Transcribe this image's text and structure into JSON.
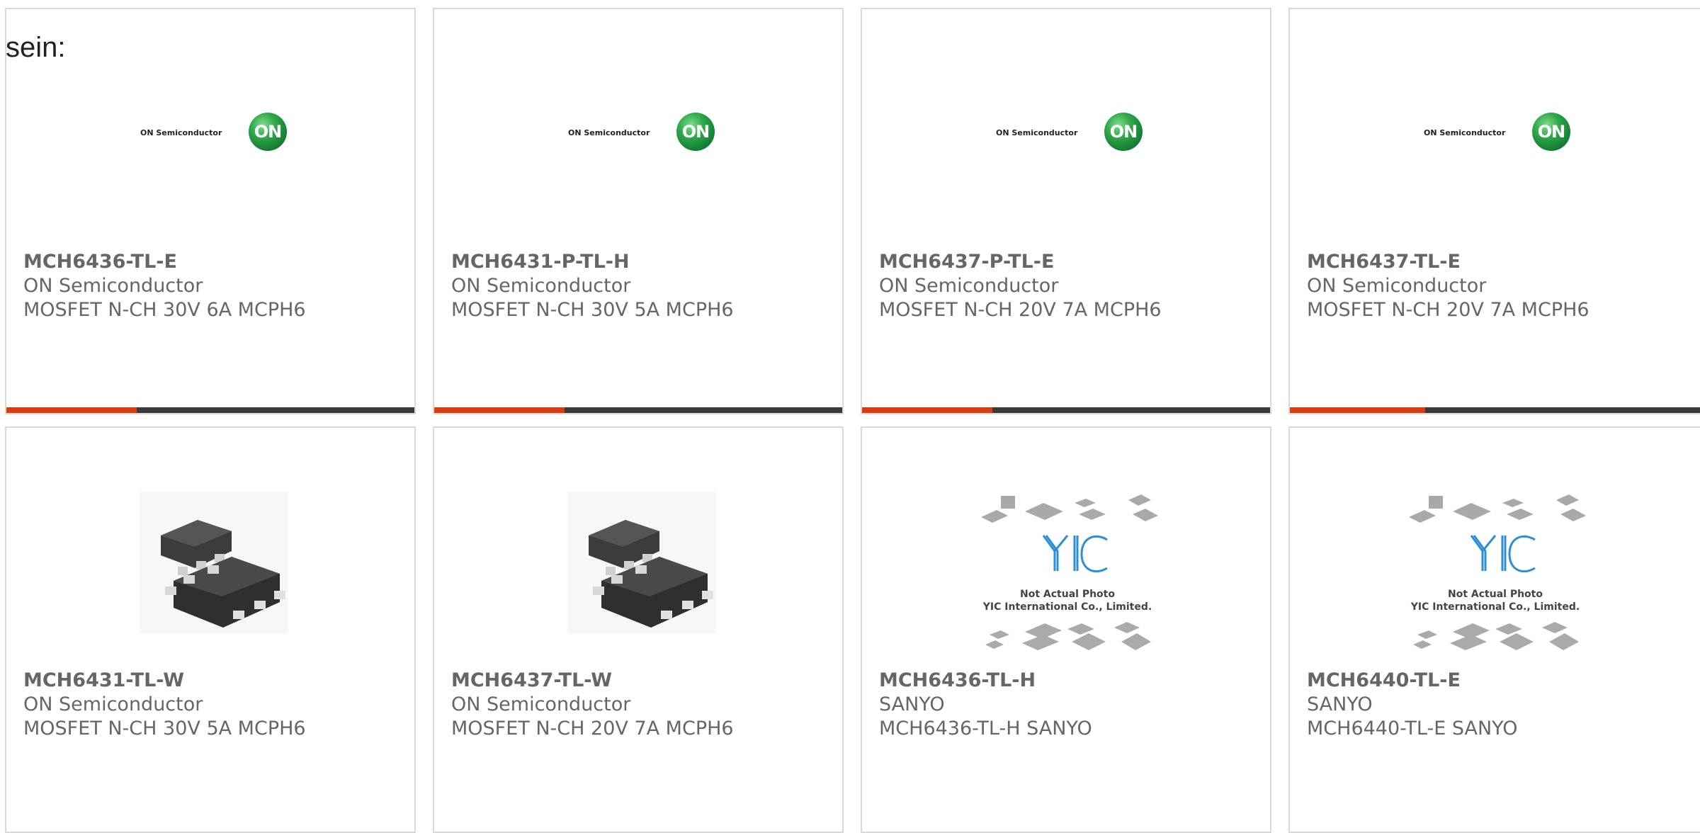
{
  "intro_text": "sein:",
  "logos": {
    "on_semiconductor_text": "ON Semiconductor",
    "on_ball_text": "ON",
    "yic_mark": "YIC",
    "yic_line1": "Not Actual Photo",
    "yic_line2": "YIC International Co., Limited."
  },
  "colors": {
    "progress_fill": "#e0380f",
    "progress_track": "#3a3a3a",
    "on_logo_green": "#2fa84a"
  },
  "products": [
    {
      "part": "MCH6436-TL-E",
      "maker": "ON Semiconductor",
      "desc": "MOSFET N-CH 30V 6A MCPH6",
      "image": "on-semiconductor-logo",
      "progress": 0.32
    },
    {
      "part": "MCH6431-P-TL-H",
      "maker": "ON Semiconductor",
      "desc": "MOSFET N-CH 30V 5A MCPH6",
      "image": "on-semiconductor-logo",
      "progress": 0.32
    },
    {
      "part": "MCH6437-P-TL-E",
      "maker": "ON Semiconductor",
      "desc": "MOSFET N-CH 20V 7A MCPH6",
      "image": "on-semiconductor-logo",
      "progress": 0.32
    },
    {
      "part": "MCH6437-TL-E",
      "maker": "ON Semiconductor",
      "desc": "MOSFET N-CH 20V 7A MCPH6",
      "image": "on-semiconductor-logo",
      "progress": 0.32
    },
    {
      "part": "MCH6431-TL-W",
      "maker": "ON Semiconductor",
      "desc": "MOSFET N-CH 30V 5A MCPH6",
      "image": "mcph6-chip-photo"
    },
    {
      "part": "MCH6437-TL-W",
      "maker": "ON Semiconductor",
      "desc": "MOSFET N-CH 20V 7A MCPH6",
      "image": "mcph6-chip-photo"
    },
    {
      "part": "MCH6436-TL-H",
      "maker": "SANYO",
      "desc": "MCH6436-TL-H SANYO",
      "image": "not-actual-photo"
    },
    {
      "part": "MCH6440-TL-E",
      "maker": "SANYO",
      "desc": "MCH6440-TL-E SANYO",
      "image": "not-actual-photo"
    }
  ]
}
